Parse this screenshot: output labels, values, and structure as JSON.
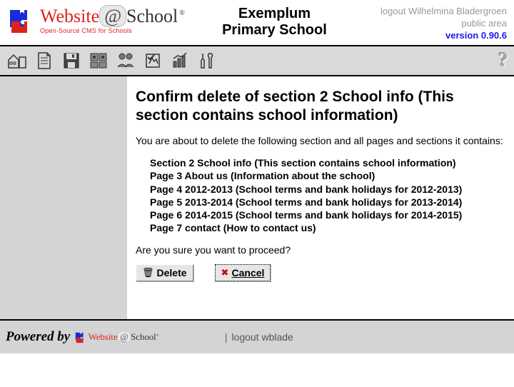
{
  "header": {
    "logo_main": "Website",
    "logo_at": "@",
    "logo_school": "School",
    "logo_sub": "Open-Source CMS for Schools",
    "school_line1": "Exemplum",
    "school_line2": "Primary School",
    "logout_text": "logout Wilhelmina Bladergroen",
    "area_text": "public area",
    "version_text": "version 0.90.6"
  },
  "toolbar": {
    "help": "?"
  },
  "content": {
    "title": "Confirm delete of section 2 School info (This section contains school information)",
    "intro": "You are about to delete the following section and all pages and sections it contains:",
    "items": [
      "Section 2 School info (This section contains school information)",
      "Page 3 About us (Information about the school)",
      "Page 4 2012-2013 (School terms and bank holidays for 2012-2013)",
      "Page 5 2013-2014 (School terms and bank holidays for 2013-2014)",
      "Page 6 2014-2015 (School terms and bank holidays for 2014-2015)",
      "Page 7 contact (How to contact us)"
    ],
    "confirm": "Are you sure you want to proceed?",
    "delete_label": "Delete",
    "cancel_label": "Cancel"
  },
  "footer": {
    "powered": "Powered by",
    "logout": "logout wblade"
  }
}
